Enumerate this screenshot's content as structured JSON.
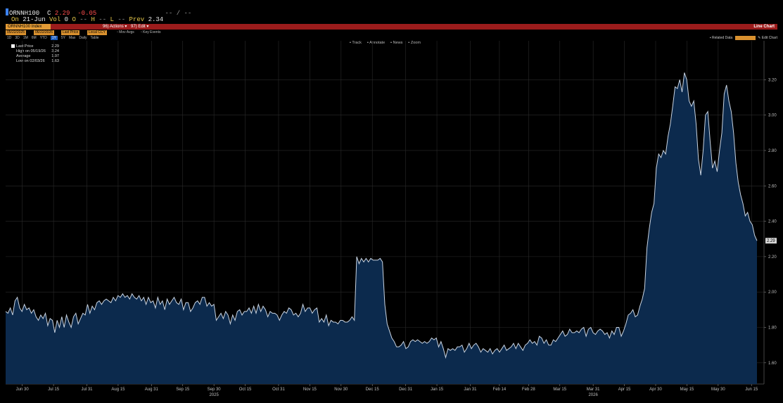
{
  "quote": {
    "ticker": "ORNNH100",
    "c_label": "C",
    "last": "2.29",
    "change": "-0.05",
    "bidask": "-- / --",
    "on_label": "On",
    "date": "21-Jun",
    "vol_label": "Vol",
    "vol": "0",
    "open_label": "O",
    "open": "--",
    "high_label": "H",
    "high": "--",
    "low_label": "L",
    "low": "--",
    "prev_label": "Prev",
    "prev": "2.34"
  },
  "toolbar": {
    "security": "ORNNH100 Index",
    "actions": "Actions",
    "edit": "Edit",
    "view_name": "Line Chart",
    "start_date": "05/22/2025",
    "end_date": "06/22/2026",
    "field": "Last Price",
    "currency": "Local CCY",
    "mov_avgs": "Mov Avgs",
    "key_events": "Key Events",
    "periods": [
      "1D",
      "3D",
      "1M",
      "6M",
      "YTD",
      "1Y",
      "5Y",
      "Max",
      "Daily"
    ],
    "selected_period": "1Y",
    "table_label": "Table",
    "related_data": "Related Data",
    "edit_chart": "Edit Chart",
    "tools": [
      "Track",
      "Annotate",
      "News",
      "Zoom"
    ]
  },
  "legend": [
    {
      "label": "Last Price",
      "value": "2.29"
    },
    {
      "label": "High on 05/19/26",
      "value": "3.24"
    },
    {
      "label": "Average",
      "value": "1.97"
    },
    {
      "label": "Low on 02/03/26",
      "value": "1.63"
    }
  ],
  "chart_data": {
    "type": "area",
    "series": [
      {
        "name": "Last Price",
        "x_start": "2025-06-22",
        "x_end": "2026-06-21",
        "values": [
          1.89,
          1.88,
          1.91,
          1.87,
          1.95,
          1.97,
          1.91,
          1.89,
          1.93,
          1.9,
          1.91,
          1.88,
          1.9,
          1.86,
          1.84,
          1.87,
          1.85,
          1.88,
          1.81,
          1.85,
          1.84,
          1.77,
          1.84,
          1.8,
          1.86,
          1.8,
          1.87,
          1.83,
          1.8,
          1.86,
          1.88,
          1.82,
          1.85,
          1.88,
          1.87,
          1.93,
          1.88,
          1.92,
          1.9,
          1.94,
          1.95,
          1.93,
          1.95,
          1.96,
          1.95,
          1.94,
          1.97,
          1.95,
          1.98,
          1.97,
          1.99,
          1.97,
          1.98,
          1.96,
          1.99,
          1.97,
          1.96,
          1.98,
          1.95,
          1.97,
          1.93,
          1.97,
          1.94,
          1.95,
          1.91,
          1.97,
          1.93,
          1.95,
          1.9,
          1.96,
          1.93,
          1.95,
          1.97,
          1.94,
          1.93,
          1.96,
          1.9,
          1.94,
          1.94,
          1.89,
          1.91,
          1.94,
          1.95,
          1.93,
          1.97,
          1.97,
          1.92,
          1.94,
          1.92,
          1.93,
          1.84,
          1.86,
          1.88,
          1.85,
          1.89,
          1.87,
          1.82,
          1.87,
          1.84,
          1.89,
          1.9,
          1.87,
          1.89,
          1.89,
          1.91,
          1.88,
          1.92,
          1.88,
          1.93,
          1.89,
          1.92,
          1.9,
          1.86,
          1.89,
          1.88,
          1.88,
          1.87,
          1.84,
          1.87,
          1.89,
          1.88,
          1.91,
          1.9,
          1.87,
          1.88,
          1.86,
          1.88,
          1.93,
          1.89,
          1.91,
          1.91,
          1.88,
          1.9,
          1.91,
          1.83,
          1.85,
          1.83,
          1.87,
          1.81,
          1.84,
          1.83,
          1.83,
          1.82,
          1.84,
          1.84,
          1.83,
          1.83,
          1.84,
          1.86,
          1.84,
          2.2,
          2.16,
          2.19,
          2.17,
          2.19,
          2.17,
          2.19,
          2.18,
          2.18,
          2.18,
          2.19,
          2.17,
          1.93,
          1.82,
          1.78,
          1.74,
          1.72,
          1.69,
          1.69,
          1.7,
          1.72,
          1.68,
          1.69,
          1.72,
          1.73,
          1.72,
          1.73,
          1.72,
          1.71,
          1.72,
          1.71,
          1.72,
          1.74,
          1.73,
          1.74,
          1.69,
          1.72,
          1.68,
          1.63,
          1.68,
          1.67,
          1.68,
          1.67,
          1.69,
          1.69,
          1.7,
          1.66,
          1.68,
          1.71,
          1.68,
          1.7,
          1.71,
          1.69,
          1.66,
          1.68,
          1.67,
          1.66,
          1.68,
          1.65,
          1.67,
          1.68,
          1.66,
          1.68,
          1.7,
          1.67,
          1.68,
          1.69,
          1.71,
          1.68,
          1.71,
          1.69,
          1.67,
          1.7,
          1.71,
          1.73,
          1.71,
          1.72,
          1.7,
          1.75,
          1.74,
          1.71,
          1.73,
          1.7,
          1.7,
          1.73,
          1.72,
          1.74,
          1.76,
          1.78,
          1.75,
          1.76,
          1.79,
          1.77,
          1.77,
          1.78,
          1.77,
          1.79,
          1.8,
          1.75,
          1.79,
          1.8,
          1.77,
          1.76,
          1.78,
          1.79,
          1.78,
          1.76,
          1.77,
          1.74,
          1.78,
          1.76,
          1.8,
          1.8,
          1.75,
          1.78,
          1.82,
          1.87,
          1.88,
          1.9,
          1.86,
          1.87,
          1.92,
          1.96,
          2.02,
          2.25,
          2.36,
          2.45,
          2.5,
          2.7,
          2.78,
          2.76,
          2.8,
          2.78,
          2.88,
          2.95,
          3.05,
          3.16,
          3.15,
          3.2,
          3.13,
          3.24,
          3.2,
          3.08,
          3.05,
          3.08,
          2.95,
          2.75,
          2.66,
          2.8,
          3.0,
          3.02,
          2.85,
          2.7,
          2.74,
          2.68,
          2.8,
          2.9,
          3.12,
          3.17,
          3.08,
          3.02,
          2.9,
          2.73,
          2.62,
          2.55,
          2.5,
          2.43,
          2.45,
          2.4,
          2.38,
          2.32,
          2.29
        ]
      }
    ],
    "ylim": [
      1.48,
      3.42
    ],
    "yticks": [
      1.6,
      1.8,
      2.0,
      2.2,
      2.4,
      2.6,
      2.8,
      3.0,
      3.2
    ],
    "ytick_labels": [
      "1.60",
      "1.80",
      "2.00",
      "2.20",
      "2.40",
      "2.60",
      "2.80",
      "3.00",
      "3.20"
    ],
    "xticks": [
      {
        "date": "2025-06-30",
        "label": "Jun 30"
      },
      {
        "date": "2025-07-15",
        "label": "Jul 15"
      },
      {
        "date": "2025-07-31",
        "label": "Jul 31"
      },
      {
        "date": "2025-08-15",
        "label": "Aug 15"
      },
      {
        "date": "2025-08-31",
        "label": "Aug 31"
      },
      {
        "date": "2025-09-15",
        "label": "Sep 15"
      },
      {
        "date": "2025-09-30",
        "label": "Sep 30"
      },
      {
        "date": "2025-10-15",
        "label": "Oct 15"
      },
      {
        "date": "2025-10-31",
        "label": "Oct 31"
      },
      {
        "date": "2025-11-15",
        "label": "Nov 15"
      },
      {
        "date": "2025-11-30",
        "label": "Nov 30"
      },
      {
        "date": "2025-12-15",
        "label": "Dec 15"
      },
      {
        "date": "2025-12-31",
        "label": "Dec 31"
      },
      {
        "date": "2026-01-15",
        "label": "Jan 15"
      },
      {
        "date": "2026-01-31",
        "label": "Jan 31"
      },
      {
        "date": "2026-02-14",
        "label": "Feb 14"
      },
      {
        "date": "2026-02-28",
        "label": "Feb 28"
      },
      {
        "date": "2026-03-15",
        "label": "Mar 15"
      },
      {
        "date": "2026-03-31",
        "label": "Mar 31"
      },
      {
        "date": "2026-04-15",
        "label": "Apr 15"
      },
      {
        "date": "2026-04-30",
        "label": "Apr 30"
      },
      {
        "date": "2026-05-15",
        "label": "May 15"
      },
      {
        "date": "2026-05-30",
        "label": "May 30"
      },
      {
        "date": "2026-06-15",
        "label": "Jun 15"
      }
    ],
    "year_labels": [
      {
        "date": "2025-09-30",
        "label": "2025"
      },
      {
        "date": "2026-03-31",
        "label": "2026"
      }
    ],
    "last_value_label": "2.29",
    "grid": true,
    "colors": {
      "line": "#c9d4e2",
      "fill": "#0c2a4d",
      "grid": "#2a2a2a",
      "axis_text": "#bfbfbf"
    }
  }
}
